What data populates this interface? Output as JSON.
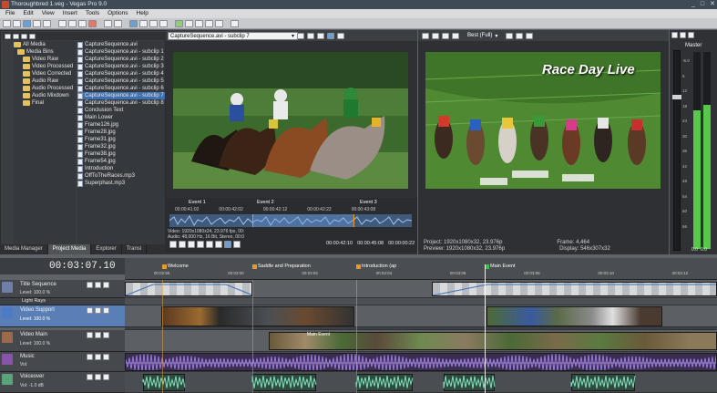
{
  "window": {
    "title": "Thoroughbred 1.veg - Vegas Pro 9.0",
    "controls": [
      "_",
      "□",
      "✕"
    ]
  },
  "menu": [
    "File",
    "Edit",
    "View",
    "Insert",
    "Tools",
    "Options",
    "Help"
  ],
  "explorer": {
    "tree": [
      "All Media",
      "Media Bins",
      "Video Raw",
      "Video Processed",
      "Video Corrected",
      "Audio Raw",
      "Audio Processed",
      "Audio Mixdown",
      "Final"
    ],
    "files": [
      "CaptureSequence.avi",
      "CaptureSequence.avi - subclip 1",
      "CaptureSequence.avi - subclip 2",
      "CaptureSequence.avi - subclip 3",
      "CaptureSequence.avi - subclip 4",
      "CaptureSequence.avi - subclip 5",
      "CaptureSequence.avi - subclip 6",
      "CaptureSequence.avi - subclip 7",
      "CaptureSequence.avi - subclip 8",
      "Conclusion Text",
      "Main Lower",
      "Frame126.jpg",
      "Frame28.jpg",
      "Frame31.jpg",
      "Frame32.jpg",
      "Frame38.jpg",
      "Frame54.jpg",
      "Introduction",
      "OffToTheRaces.mp3",
      "Superphast.mp3"
    ],
    "tabs": [
      "Media Manager",
      "Project Media",
      "Explorer",
      "Transi"
    ]
  },
  "trimmer": {
    "clip": "CaptureSequence.avi - subclip 7",
    "events": [
      "Event 1",
      "Event 2",
      "Event 3"
    ],
    "ticks": [
      "00:00:41:02",
      "00:00:42:02",
      "00:00:42:12",
      "00:00:42:22",
      "00:00:43:08"
    ],
    "info1": "Video: 1920x1080x24, 23.976 fps, 00:",
    "info2": "Audio: 48,000 Hz, 16 Bit, Stereo, 00:0",
    "time_in": "00:00:42:10",
    "time_out": "00:00:45:08",
    "length": "00:00:00:22"
  },
  "preview": {
    "quality": "Best (Full)",
    "overlay_title": "Race Day Live",
    "project": "Project: 1920x1080x32, 23.976p",
    "preview": "Preview: 1920x1080x32, 23.976p",
    "frame": "Frame:    4,464",
    "display": "Display:  546x307x32"
  },
  "master": {
    "label": "Master",
    "scale": [
      "-6.0",
      "6",
      "12",
      "18",
      "24",
      "30",
      "36",
      "42",
      "48",
      "54",
      "60",
      "66",
      "72"
    ],
    "level_left": "0.0",
    "level_right": "0.0"
  },
  "timeline": {
    "timecode": "00:03:07.10",
    "markers": [
      "Welcome",
      "Saddle and Preparation",
      "Introduction (ap",
      "Main Event"
    ],
    "ruler_ticks": [
      "00:02:56",
      "00:03:00",
      "00:03:02",
      "00:03:04",
      "00:03:06",
      "00:03:08",
      "00:03:10",
      "00:03:12"
    ],
    "tracks": [
      {
        "name": "Title Sequence",
        "level": "Level: 100.0 %",
        "color": "#6f7fa8"
      },
      {
        "name": "Light Rays",
        "level": "",
        "color": "#5a5e63"
      },
      {
        "name": "Video Support",
        "level": "Level: 100.0 %",
        "color": "#4b7bc7"
      },
      {
        "name": "Video Main",
        "level": "Level: 100.0 %",
        "color": "#9a6a4b"
      },
      {
        "name": "Music",
        "level": "Vol:",
        "color": "#8654a8"
      },
      {
        "name": "Voiceover",
        "level": "Vol: -1.0 dB",
        "color": "#5aa27a"
      }
    ],
    "sub_labels": [
      "Vol:",
      "-1.0 dB"
    ],
    "clip_label": "Main Event"
  },
  "colors": {
    "accent": "#3e6fb0",
    "music_wave": "#7b55b5",
    "voice_wave": "#6ec9a8",
    "meter": "#58c84a"
  }
}
